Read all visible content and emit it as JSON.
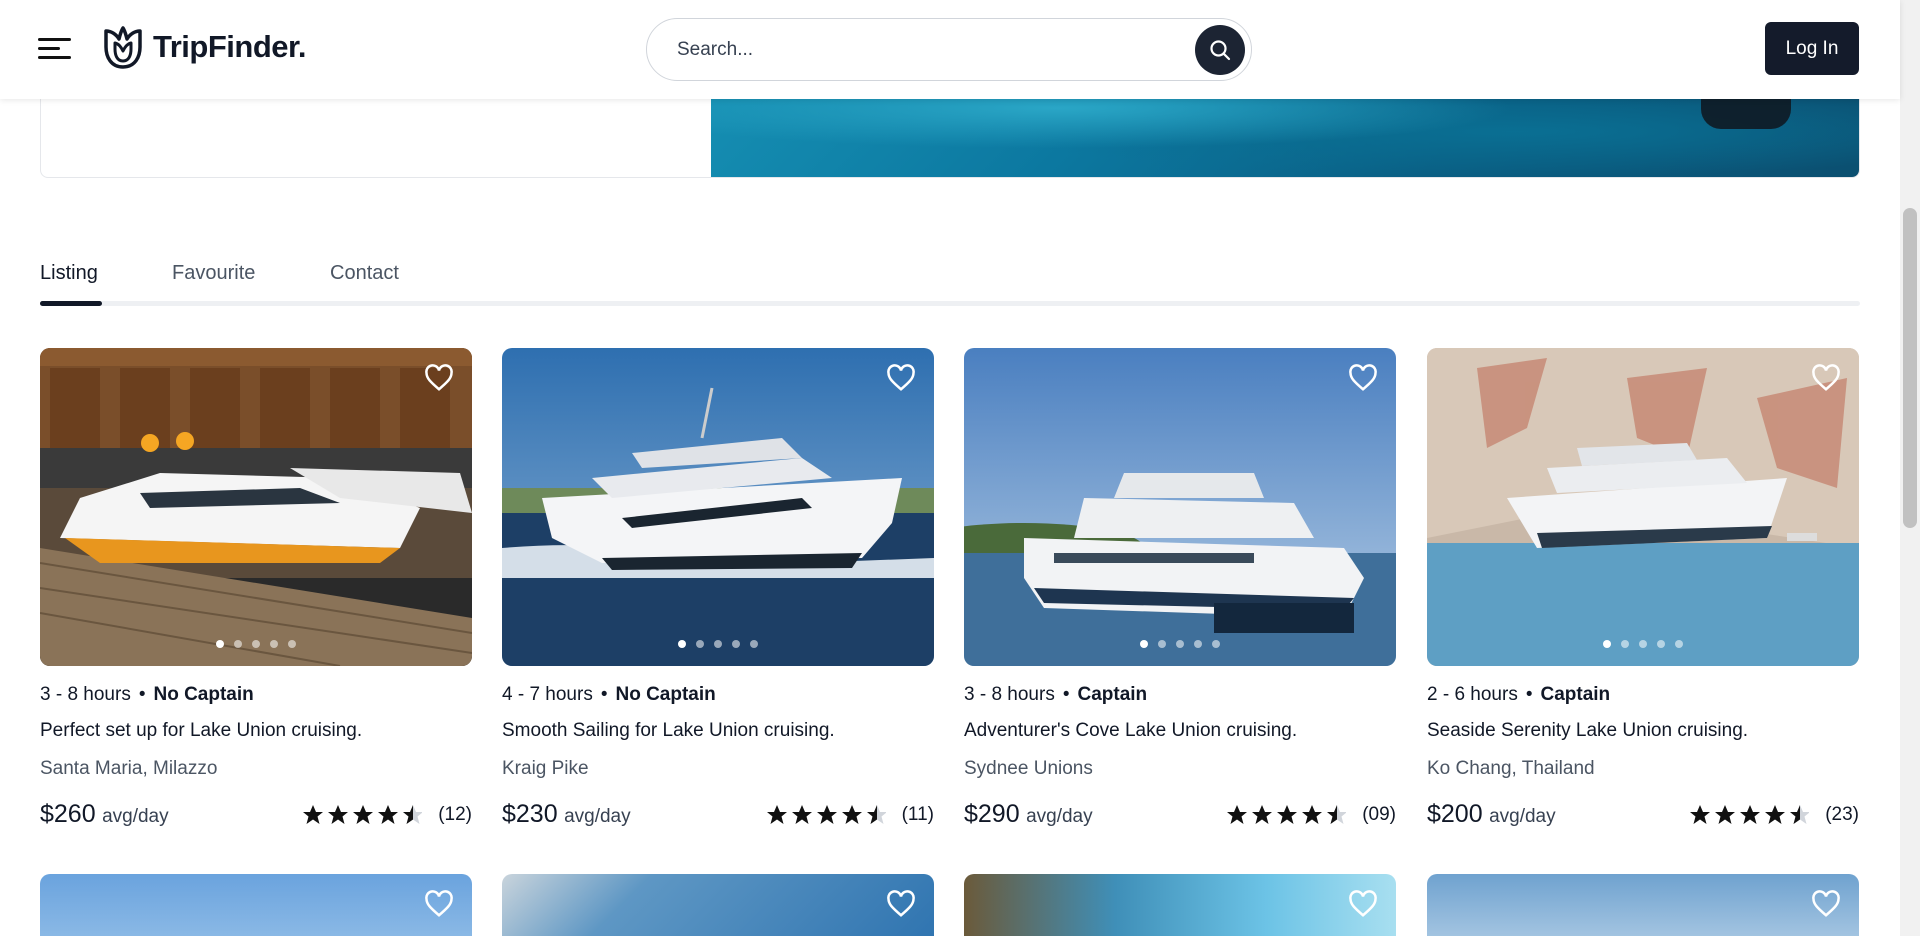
{
  "header": {
    "logo_text": "TripFinder.",
    "search_placeholder": "Search...",
    "login_label": "Log In"
  },
  "tabs": [
    {
      "label": "Listing",
      "active": true
    },
    {
      "label": "Favourite",
      "active": false
    },
    {
      "label": "Contact",
      "active": false
    }
  ],
  "listings": [
    {
      "hours": "3 - 8 hours",
      "captain": "No Captain",
      "title": "Perfect set up for Lake Union cruising.",
      "location": "Santa Maria, Milazzo",
      "price": "$260",
      "price_unit": "avg/day",
      "rating": 4.5,
      "reviews": "(12)",
      "image": "yacht-at-dock-orange"
    },
    {
      "hours": "4 - 7 hours",
      "captain": "No Captain",
      "title": "Smooth Sailing for Lake Union cruising.",
      "location": "Kraig Pike",
      "price": "$230",
      "price_unit": "avg/day",
      "rating": 4.5,
      "reviews": "(11)",
      "image": "white-yacht-speeding"
    },
    {
      "hours": "3 - 8 hours",
      "captain": "Captain",
      "title": "Adventurer's Cove Lake Union cruising.",
      "location": "Sydnee Unions",
      "price": "$290",
      "price_unit": "avg/day",
      "rating": 4.5,
      "reviews": "(09)",
      "image": "ferry-catamaran"
    },
    {
      "hours": "2 - 6 hours",
      "captain": "Captain",
      "title": "Seaside Serenity Lake Union cruising.",
      "location": "Ko Chang, Thailand",
      "price": "$200",
      "price_unit": "avg/day",
      "rating": 4.5,
      "reviews": "(23)",
      "image": "superyacht-near-cliff"
    }
  ],
  "carousel": {
    "dot_count": 5,
    "active_index": 0
  },
  "colors": {
    "primary": "#141b2b",
    "text": "#111827",
    "muted": "#4b5563"
  }
}
